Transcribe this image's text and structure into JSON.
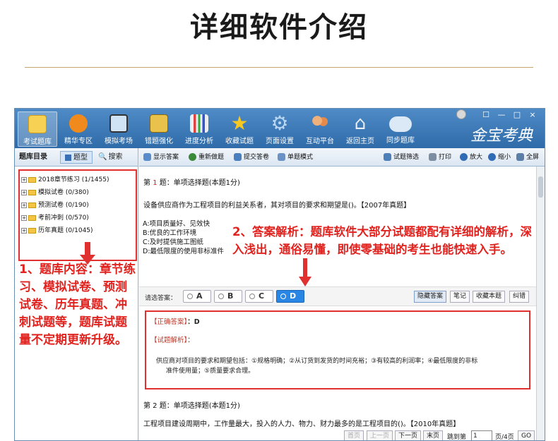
{
  "heading": "详细软件介绍",
  "toolbar": {
    "items": [
      {
        "label": "考试题库",
        "icon": "notebook-icon",
        "color": "#f7d154"
      },
      {
        "label": "精华专区",
        "icon": "play-disc-icon",
        "color": "#f08a1c"
      },
      {
        "label": "模拟考场",
        "icon": "monitor-icon",
        "color": "#cfe3f5"
      },
      {
        "label": "错题强化",
        "icon": "locked-book-icon",
        "color": "#e8c24a"
      },
      {
        "label": "进度分析",
        "icon": "bar-chart-icon",
        "color": "#e9eef3"
      },
      {
        "label": "收藏试题",
        "icon": "star-icon",
        "color": "#f7c820"
      },
      {
        "label": "页面设置",
        "icon": "gear-icon",
        "color": "#b9d6f2"
      },
      {
        "label": "互动平台",
        "icon": "users-icon",
        "color": "#f0b07a"
      },
      {
        "label": "返回主页",
        "icon": "home-icon",
        "color": "#e9eef3"
      },
      {
        "label": "同步题库",
        "icon": "cloud-sync-icon",
        "color": "#dbe8f6"
      }
    ],
    "brand": "金宝考典",
    "window_controls": [
      "☐",
      "—",
      "□",
      "×"
    ]
  },
  "left_panel": {
    "tabs": [
      "题库目录",
      "题型",
      "搜索"
    ],
    "tree": [
      "2018章节练习 (1/1455)",
      "模拟试卷 (0/380)",
      "预测试卷 (0/190)",
      "考前冲刺 (0/570)",
      "历年真题 (0/1045)"
    ],
    "annotation": "1、题库内容：章节练习、模拟试卷、预测试卷、历年真题、冲刺试题等，题库试题量不定期更新升级。"
  },
  "right_toolbar": {
    "buttons": [
      "显示答案",
      "重新做题",
      "提交答卷",
      "单题模式",
      "试题筛选",
      "打印",
      "放大",
      "缩小",
      "全屏"
    ]
  },
  "question1": {
    "number_prefix": "第",
    "number": "1",
    "suffix": "题：单项选择题(本题1分)",
    "stem": "设备供应商作为工程项目的利益关系者，其对项目的要求和期望是()。【2007年真题】",
    "options": [
      "A:项目质量好、见效快",
      "B:优良的工作环境",
      "C:及时提供施工图纸",
      "D:最低限度的使用非标准件"
    ]
  },
  "answer_annotation": "2、答案解析：题库软件大部分试题都配有详细的解析，深入浅出，通俗易懂，即使零基础的考生也能快速入手。",
  "choice_bar": {
    "label": "请选答案：",
    "choices": [
      "A",
      "B",
      "C",
      "D"
    ],
    "selected": "D",
    "buttons": [
      "隐藏答案",
      "笔记",
      "收藏本题",
      "纠错"
    ]
  },
  "analysis": {
    "correct_label": "【正确答案】",
    "correct_value": "：D",
    "analysis_label": "【试题解析】",
    "analysis_colon": "：",
    "text_line1": "供应商对项目的要求和期望包括：①规格明确；②从订货到发货的时间充裕；③有较高的利润率；④最低限度的非标",
    "text_line2": "准件使用量；⑤质量要求合理。"
  },
  "question2": {
    "header": "第 2 题：单项选择题(本题1分)",
    "stem": "工程项目建设周期中，工作量最大，投入的人力、物力、财力最多的是工程项目的()。【2010年真题】"
  },
  "pager": {
    "first": "首页",
    "prev": "上一页",
    "next": "下一页",
    "last": "末页",
    "jump_label": "跳到第",
    "page_value": "1",
    "total": "页/4页",
    "go": "GO"
  }
}
